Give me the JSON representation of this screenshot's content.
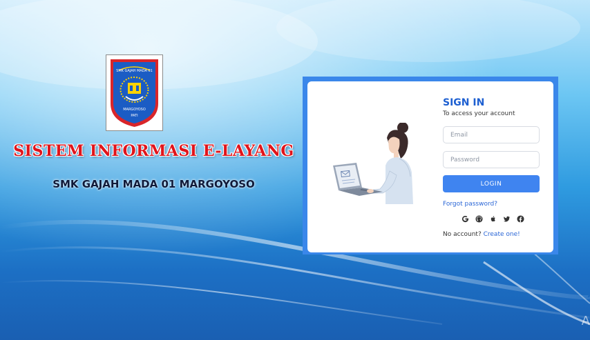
{
  "brand": {
    "title": "SISTEM INFORMASI E-LAYANG",
    "subtitle": "SMK GAJAH MADA 01 MARGOYOSO",
    "logo_text_top": "SMK GAJAH MADA 01",
    "logo_text_mid": "MARGOYOSO",
    "logo_text_bottom": "PATI"
  },
  "login": {
    "title": "SIGN IN",
    "subtitle": "To access your account",
    "email_placeholder": "Email",
    "password_placeholder": "Password",
    "button_label": "LOGIN",
    "forgot_label": "Forgot password?",
    "no_account_text": "No account?",
    "create_link": "Create one!",
    "social_icons": [
      "google-icon",
      "github-icon",
      "apple-icon",
      "twitter-icon",
      "facebook-icon"
    ]
  },
  "colors": {
    "accent": "#3f84f0",
    "title_blue": "#1d5fd1",
    "brand_red": "#e0141b",
    "card_frame": "#3a87ea"
  },
  "watermark": "A"
}
